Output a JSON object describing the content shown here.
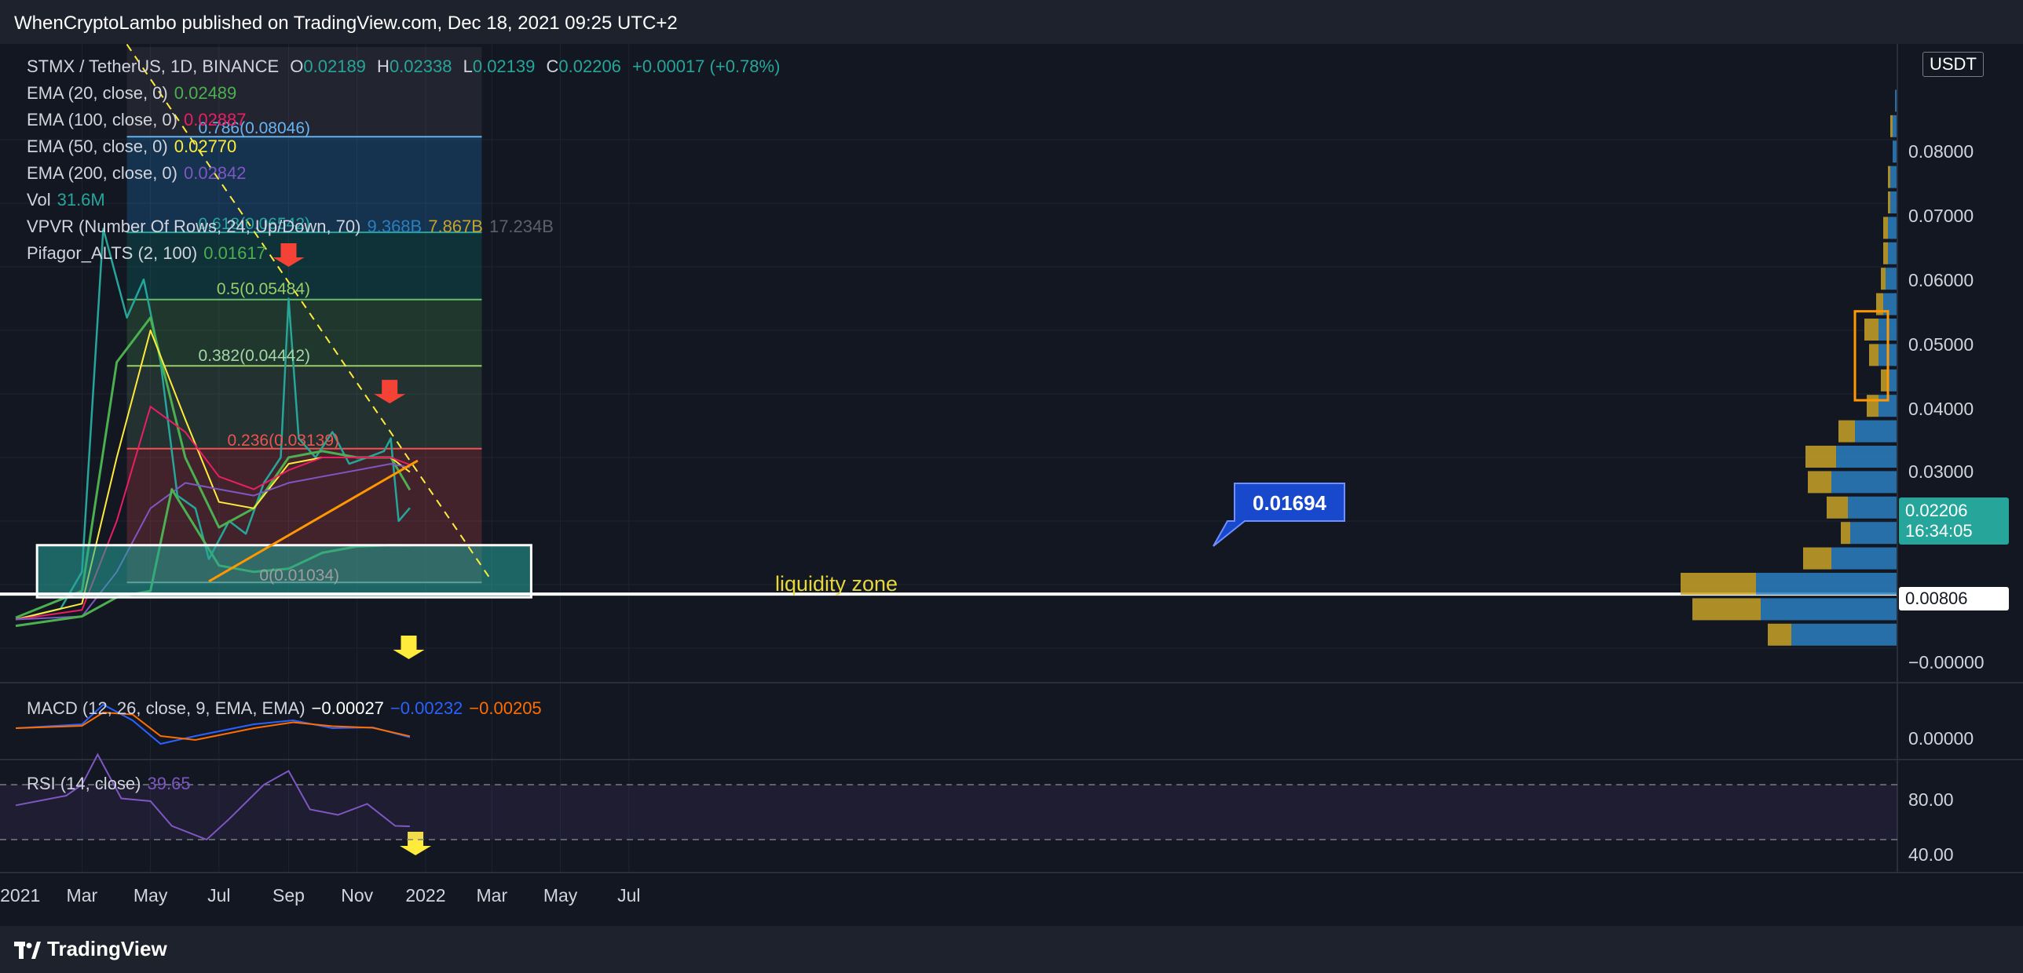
{
  "header": {
    "text": "WhenCryptoLambo published on TradingView.com, Dec 18, 2021 09:25 UTC+2"
  },
  "footer": {
    "brand": "TradingView"
  },
  "legend": {
    "symbol": "STMX / TetherUS, 1D, BINANCE",
    "o_label": "O",
    "o_value": "0.02189",
    "h_label": "H",
    "h_value": "0.02338",
    "l_label": "L",
    "l_value": "0.02139",
    "c_label": "C",
    "c_value": "0.02206",
    "change": "+0.00017 (+0.78%)",
    "ema20_label": "EMA (20, close, 0)",
    "ema20_value": "0.02489",
    "ema100_label": "EMA (100, close, 0)",
    "ema100_value": "0.02887",
    "ema50_label": "EMA (50, close, 0)",
    "ema50_value": "0.02770",
    "ema200_label": "EMA (200, close, 0)",
    "ema200_value": "0.02842",
    "vol_label": "Vol",
    "vol_value": "31.6M",
    "vpvr_label": "VPVR (Number Of Rows, 24, Up/Down, 70)",
    "vpvr_up": "9.368B",
    "vpvr_down": "7.867B",
    "vpvr_total": "17.234B",
    "pifagor_label": "Pifagor_ALTS (2, 100)",
    "pifagor_value": "0.01617",
    "macd_label": "MACD (12, 26, close, 9, EMA, EMA)",
    "macd_hist": "−0.00027",
    "macd_value": "−0.00232",
    "macd_signal": "−0.00205",
    "rsi_label": "RSI (14, close)",
    "rsi_value": "39.65"
  },
  "colors": {
    "background": "#131722",
    "up": "#26a69a",
    "down": "#ef5350",
    "ema20": "#4caf50",
    "ema50": "#ffeb3b",
    "ema100": "#e91e63",
    "ema200": "#7e57c2",
    "pifagor": "#4caf50",
    "trendline": "#ff9800",
    "resistance": "#ffeb3b",
    "vp_up": "#2a7fbf",
    "vp_down": "#c9a227",
    "macd": "#2962ff",
    "signal": "#ff6d00",
    "rsi": "#7e57c2"
  },
  "price_axis": {
    "currency": "USDT",
    "labels": [
      "0.08000",
      "0.07000",
      "0.06000",
      "0.05000",
      "0.04000",
      "0.03000",
      "0.01000",
      "−0.00000"
    ],
    "current_price": "0.02206",
    "countdown": "16:34:05",
    "level_badge": "0.00806"
  },
  "macd_axis": {
    "labels": [
      "0.00000"
    ]
  },
  "rsi_axis": {
    "labels": [
      "80.00",
      "40.00"
    ]
  },
  "time_axis": {
    "labels": [
      "2021",
      "Mar",
      "May",
      "Jul",
      "Sep",
      "Nov",
      "2022",
      "Mar",
      "May",
      "Jul"
    ]
  },
  "fib_labels": {
    "f0786": "0.786(0.08046)",
    "f0618": "0.618(0.06542)",
    "f05": "0.5(0.05484)",
    "f0382": "0.382(0.04442)",
    "f0236": "0.236(0.03139)",
    "f0": "0(0.01034)"
  },
  "annotations": {
    "zone_label": "liquidity zone",
    "callout": "0.01694"
  },
  "chart_data": {
    "type": "line",
    "title": "STMX / TetherUS, 1D, BINANCE",
    "x_range": [
      "2021-01-01",
      "2022-07-15"
    ],
    "ylim": [
      0,
      0.09
    ],
    "series": [
      {
        "name": "STMX / TetherUS",
        "x": [
          "2021-01-01",
          "2021-02-10",
          "2021-03-01",
          "2021-03-20",
          "2021-04-10",
          "2021-04-25",
          "2021-05-10",
          "2021-05-25",
          "2021-06-10",
          "2021-06-22",
          "2021-07-10",
          "2021-07-25",
          "2021-08-10",
          "2021-08-25",
          "2021-09-01",
          "2021-09-10",
          "2021-09-25",
          "2021-10-10",
          "2021-10-25",
          "2021-11-10",
          "2021-11-25",
          "2021-12-01",
          "2021-12-08",
          "2021-12-18"
        ],
        "values": [
          0.0045,
          0.0062,
          0.012,
          0.066,
          0.052,
          0.058,
          0.045,
          0.024,
          0.022,
          0.014,
          0.02,
          0.018,
          0.026,
          0.03,
          0.055,
          0.033,
          0.03,
          0.034,
          0.029,
          0.03,
          0.031,
          0.033,
          0.02,
          0.02206
        ]
      },
      {
        "name": "EMA (20, close, 0)",
        "x": [
          "2021-01-01",
          "2021-03-01",
          "2021-04-01",
          "2021-05-01",
          "2021-06-01",
          "2021-07-01",
          "2021-08-01",
          "2021-09-01",
          "2021-10-01",
          "2021-11-01",
          "2021-12-01",
          "2021-12-18"
        ],
        "values": [
          0.0048,
          0.009,
          0.045,
          0.052,
          0.03,
          0.019,
          0.022,
          0.03,
          0.031,
          0.03,
          0.03,
          0.02489
        ]
      },
      {
        "name": "EMA (50, close, 0)",
        "x": [
          "2021-01-01",
          "2021-03-01",
          "2021-04-01",
          "2021-05-01",
          "2021-06-01",
          "2021-07-01",
          "2021-08-01",
          "2021-09-01",
          "2021-10-01",
          "2021-11-01",
          "2021-12-01",
          "2021-12-18"
        ],
        "values": [
          0.0045,
          0.007,
          0.03,
          0.05,
          0.036,
          0.023,
          0.022,
          0.029,
          0.03,
          0.03,
          0.03,
          0.0277
        ]
      },
      {
        "name": "EMA (100, close, 0)",
        "x": [
          "2021-01-01",
          "2021-03-01",
          "2021-04-01",
          "2021-05-01",
          "2021-06-01",
          "2021-07-01",
          "2021-08-01",
          "2021-09-01",
          "2021-10-01",
          "2021-11-01",
          "2021-12-01",
          "2021-12-18"
        ],
        "values": [
          0.0045,
          0.006,
          0.02,
          0.038,
          0.034,
          0.027,
          0.025,
          0.028,
          0.03,
          0.03,
          0.03,
          0.02887
        ]
      },
      {
        "name": "EMA (200, close, 0)",
        "x": [
          "2021-01-01",
          "2021-03-01",
          "2021-04-01",
          "2021-05-01",
          "2021-06-01",
          "2021-07-01",
          "2021-08-01",
          "2021-09-01",
          "2021-10-01",
          "2021-11-01",
          "2021-12-01",
          "2021-12-18"
        ],
        "values": [
          0.0045,
          0.005,
          0.012,
          0.022,
          0.026,
          0.025,
          0.024,
          0.026,
          0.027,
          0.028,
          0.029,
          0.02842
        ]
      },
      {
        "name": "Pifagor_ALTS (2, 100)",
        "x": [
          "2021-01-01",
          "2021-03-01",
          "2021-04-01",
          "2021-05-01",
          "2021-05-20",
          "2021-07-01",
          "2021-08-01",
          "2021-09-01",
          "2021-10-01",
          "2021-11-01",
          "2021-12-01",
          "2021-12-18"
        ],
        "values": [
          0.0035,
          0.005,
          0.008,
          0.009,
          0.025,
          0.013,
          0.012,
          0.0125,
          0.015,
          0.016,
          0.0162,
          0.01617
        ]
      }
    ],
    "fib_levels": [
      {
        "ratio": 0.786,
        "value": 0.08046
      },
      {
        "ratio": 0.618,
        "value": 0.06542
      },
      {
        "ratio": 0.5,
        "value": 0.05484
      },
      {
        "ratio": 0.382,
        "value": 0.04442
      },
      {
        "ratio": 0.236,
        "value": 0.03139
      },
      {
        "ratio": 0,
        "value": 0.01034
      }
    ],
    "liquidity_zone": {
      "x": [
        "2021-01-20",
        "2022-04-05"
      ],
      "y": [
        0.008,
        0.0162
      ]
    },
    "trendlines": [
      {
        "name": "support",
        "x": [
          "2021-06-22",
          "2021-12-25"
        ],
        "y": [
          0.0105,
          0.0295
        ]
      },
      {
        "name": "resistance",
        "x": [
          "2021-04-10",
          "2022-02-28"
        ],
        "y": [
          0.095,
          0.0108
        ]
      }
    ],
    "markers": [
      {
        "type": "down-arrow",
        "x": "2021-09-01",
        "y": 0.06
      },
      {
        "type": "down-arrow",
        "x": "2021-11-30",
        "y": 0.0385
      },
      {
        "type": "down-arrow",
        "x": "2021-12-17",
        "y": 0.0
      }
    ],
    "volume_profile": [
      {
        "price": 0.002,
        "up": 0.45,
        "down": 0.1
      },
      {
        "price": 0.006,
        "up": 0.58,
        "down": 0.29
      },
      {
        "price": 0.01,
        "up": 0.6,
        "down": 0.32
      },
      {
        "price": 0.014,
        "up": 0.28,
        "down": 0.12
      },
      {
        "price": 0.018,
        "up": 0.2,
        "down": 0.04
      },
      {
        "price": 0.022,
        "up": 0.21,
        "down": 0.09
      },
      {
        "price": 0.026,
        "up": 0.28,
        "down": 0.1
      },
      {
        "price": 0.03,
        "up": 0.26,
        "down": 0.13
      },
      {
        "price": 0.034,
        "up": 0.18,
        "down": 0.07
      },
      {
        "price": 0.038,
        "up": 0.08,
        "down": 0.05
      },
      {
        "price": 0.042,
        "up": 0.04,
        "down": 0.03
      },
      {
        "price": 0.046,
        "up": 0.08,
        "down": 0.04
      },
      {
        "price": 0.05,
        "up": 0.08,
        "down": 0.06
      },
      {
        "price": 0.054,
        "up": 0.06,
        "down": 0.03
      },
      {
        "price": 0.058,
        "up": 0.05,
        "down": 0.02
      },
      {
        "price": 0.062,
        "up": 0.04,
        "down": 0.02
      },
      {
        "price": 0.066,
        "up": 0.04,
        "down": 0.02
      },
      {
        "price": 0.07,
        "up": 0.03,
        "down": 0.01
      },
      {
        "price": 0.074,
        "up": 0.03,
        "down": 0.01
      },
      {
        "price": 0.078,
        "up": 0.02,
        "down": 0.0
      },
      {
        "price": 0.082,
        "up": 0.02,
        "down": 0.01
      },
      {
        "price": 0.086,
        "up": 0.01,
        "down": 0.0
      }
    ],
    "rsi": {
      "ylim": [
        20,
        100
      ],
      "bands": [
        70,
        30
      ],
      "x": [
        "2021-01-01",
        "2021-02-15",
        "2021-03-01",
        "2021-03-15",
        "2021-04-05",
        "2021-05-01",
        "2021-05-20",
        "2021-06-20",
        "2021-07-10",
        "2021-08-10",
        "2021-09-01",
        "2021-09-20",
        "2021-10-15",
        "2021-11-10",
        "2021-12-05",
        "2021-12-18"
      ],
      "values": [
        55,
        62,
        70,
        92,
        60,
        58,
        40,
        30,
        45,
        70,
        80,
        52,
        48,
        56,
        40,
        39.65
      ]
    },
    "macd": {
      "x": [
        "2021-01-01",
        "2021-03-01",
        "2021-03-20",
        "2021-04-15",
        "2021-05-10",
        "2021-06-10",
        "2021-08-01",
        "2021-09-05",
        "2021-10-10",
        "2021-11-15",
        "2021-12-18"
      ],
      "macd": [
        0.0,
        0.001,
        0.006,
        0.002,
        -0.004,
        -0.002,
        0.001,
        0.002,
        0.0,
        0.0002,
        -0.00232
      ],
      "signal": [
        0.0,
        0.0006,
        0.004,
        0.0035,
        -0.002,
        -0.003,
        0.0,
        0.0015,
        0.0005,
        0.0001,
        -0.00205
      ]
    }
  }
}
